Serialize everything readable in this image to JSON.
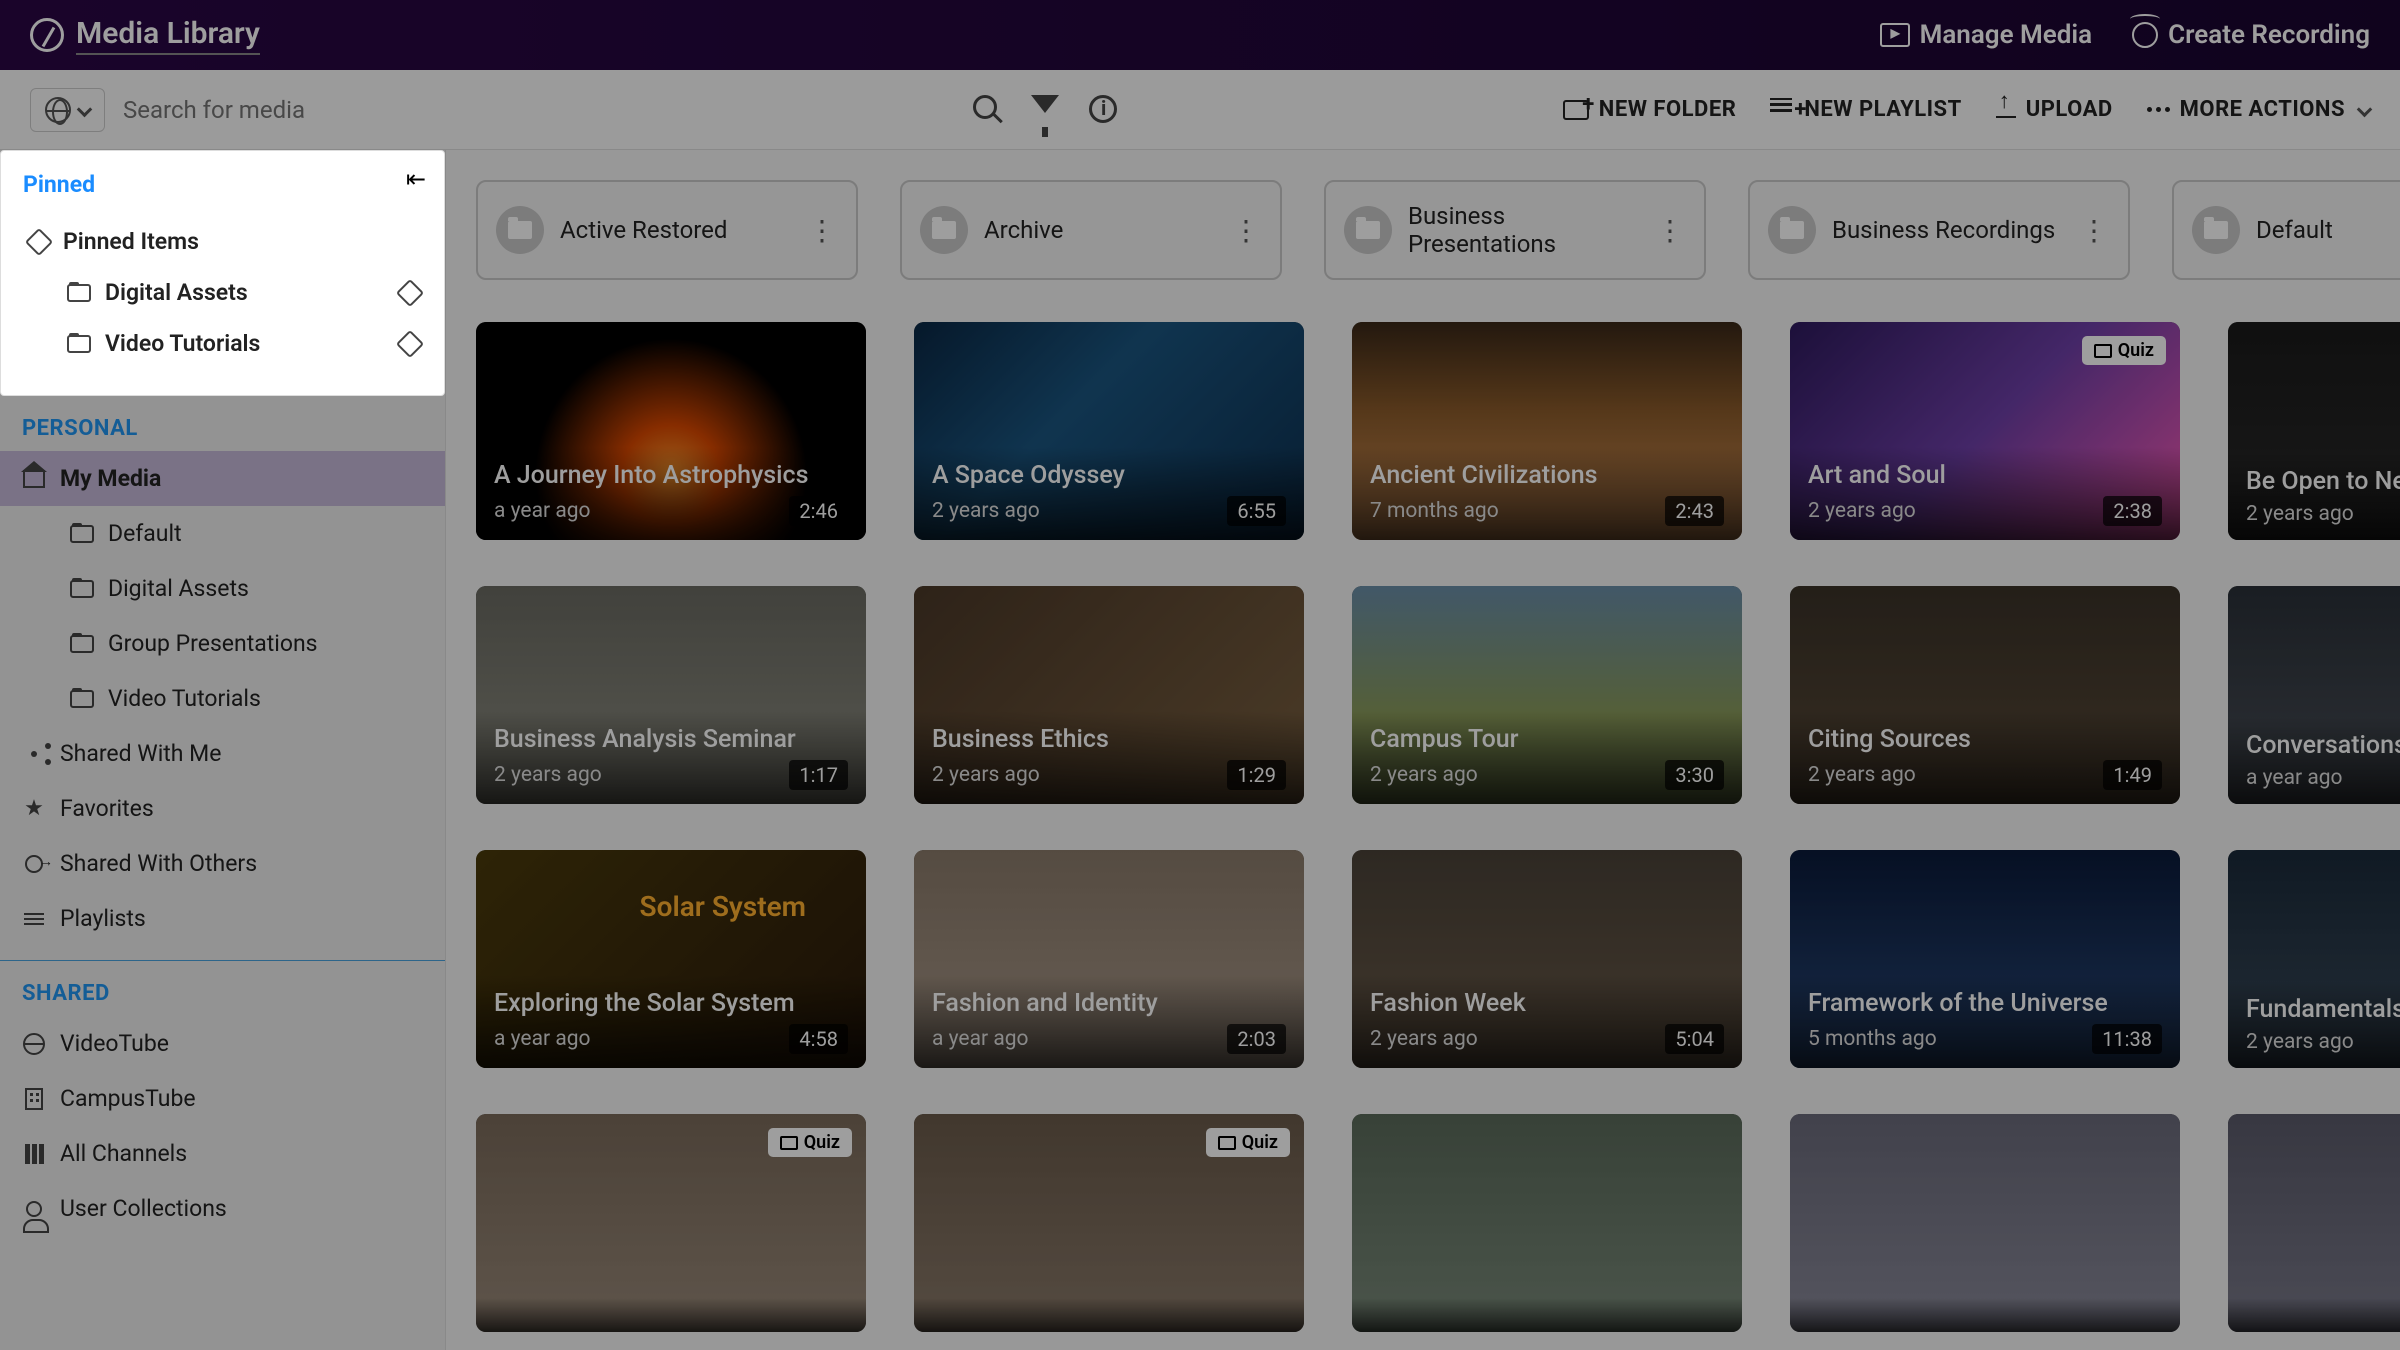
{
  "header": {
    "title": "Media Library",
    "manage": "Manage Media",
    "create": "Create Recording"
  },
  "toolbar": {
    "search_placeholder": "Search for media",
    "new_folder": "NEW FOLDER",
    "new_playlist": "NEW PLAYLIST",
    "upload": "UPLOAD",
    "more": "MORE ACTIONS"
  },
  "sidebar": {
    "pinned_title": "Pinned",
    "pinned_items_label": "Pinned Items",
    "pinned": [
      "Digital Assets",
      "Video Tutorials"
    ],
    "personal_title": "PERSONAL",
    "my_media": "My Media",
    "personal_folders": [
      "Default",
      "Digital Assets",
      "Group Presentations",
      "Video Tutorials"
    ],
    "shared_with_me": "Shared With Me",
    "favorites": "Favorites",
    "shared_with_others": "Shared With Others",
    "playlists": "Playlists",
    "shared_title": "SHARED",
    "shared_items": [
      "VideoTube",
      "CampusTube",
      "All Channels",
      "User Collections"
    ]
  },
  "folders": [
    {
      "name": "Active Restored"
    },
    {
      "name": "Archive"
    },
    {
      "name": "Business Presentations"
    },
    {
      "name": "Business Recordings"
    },
    {
      "name": "Default"
    }
  ],
  "videos": [
    [
      {
        "title": "A Journey Into Astrophysics",
        "age": "a year ago",
        "dur": "2:46",
        "cls": "g-astro"
      },
      {
        "title": "A Space Odyssey",
        "age": "2 years ago",
        "dur": "6:55",
        "cls": "g-space"
      },
      {
        "title": "Ancient Civilizations",
        "age": "7 months ago",
        "dur": "2:43",
        "cls": "g-ancient"
      },
      {
        "title": "Art and Soul",
        "age": "2 years ago",
        "dur": "2:38",
        "cls": "g-art",
        "badge": "Quiz"
      },
      {
        "title": "Be Open to New",
        "age": "2 years ago",
        "dur": "",
        "cls": "g-bulb"
      }
    ],
    [
      {
        "title": "Business Analysis Seminar",
        "age": "2 years ago",
        "dur": "1:17",
        "cls": "g-biz"
      },
      {
        "title": "Business Ethics",
        "age": "2 years ago",
        "dur": "1:29",
        "cls": "g-ethics"
      },
      {
        "title": "Campus Tour",
        "age": "2 years ago",
        "dur": "3:30",
        "cls": "g-campus"
      },
      {
        "title": "Citing Sources",
        "age": "2 years ago",
        "dur": "1:49",
        "cls": "g-citing"
      },
      {
        "title": "Conversations Wi",
        "age": "a year ago",
        "dur": "",
        "cls": "g-conv"
      }
    ],
    [
      {
        "title": "Exploring the Solar System",
        "age": "a year ago",
        "dur": "4:58",
        "cls": "g-solar"
      },
      {
        "title": "Fashion and Identity",
        "age": "a year ago",
        "dur": "2:03",
        "cls": "g-fashion"
      },
      {
        "title": "Fashion Week",
        "age": "2 years ago",
        "dur": "5:04",
        "cls": "g-fashion2"
      },
      {
        "title": "Framework of the Universe",
        "age": "5 months ago",
        "dur": "11:38",
        "cls": "g-framework"
      },
      {
        "title": "Fundamentals of",
        "age": "2 years ago",
        "dur": "",
        "cls": "g-fund"
      }
    ],
    [
      {
        "title": "",
        "age": "",
        "dur": "",
        "cls": "g-lib1",
        "badge": "Quiz"
      },
      {
        "title": "",
        "age": "",
        "dur": "",
        "cls": "g-lib2",
        "badge": "Quiz"
      },
      {
        "title": "",
        "age": "",
        "dur": "",
        "cls": "g-lib3"
      },
      {
        "title": "",
        "age": "",
        "dur": "",
        "cls": "g-lib4"
      },
      {
        "title": "",
        "age": "",
        "dur": "",
        "cls": "g-lib5"
      }
    ]
  ],
  "badge_quiz": "Quiz",
  "solar_label": "Solar System"
}
